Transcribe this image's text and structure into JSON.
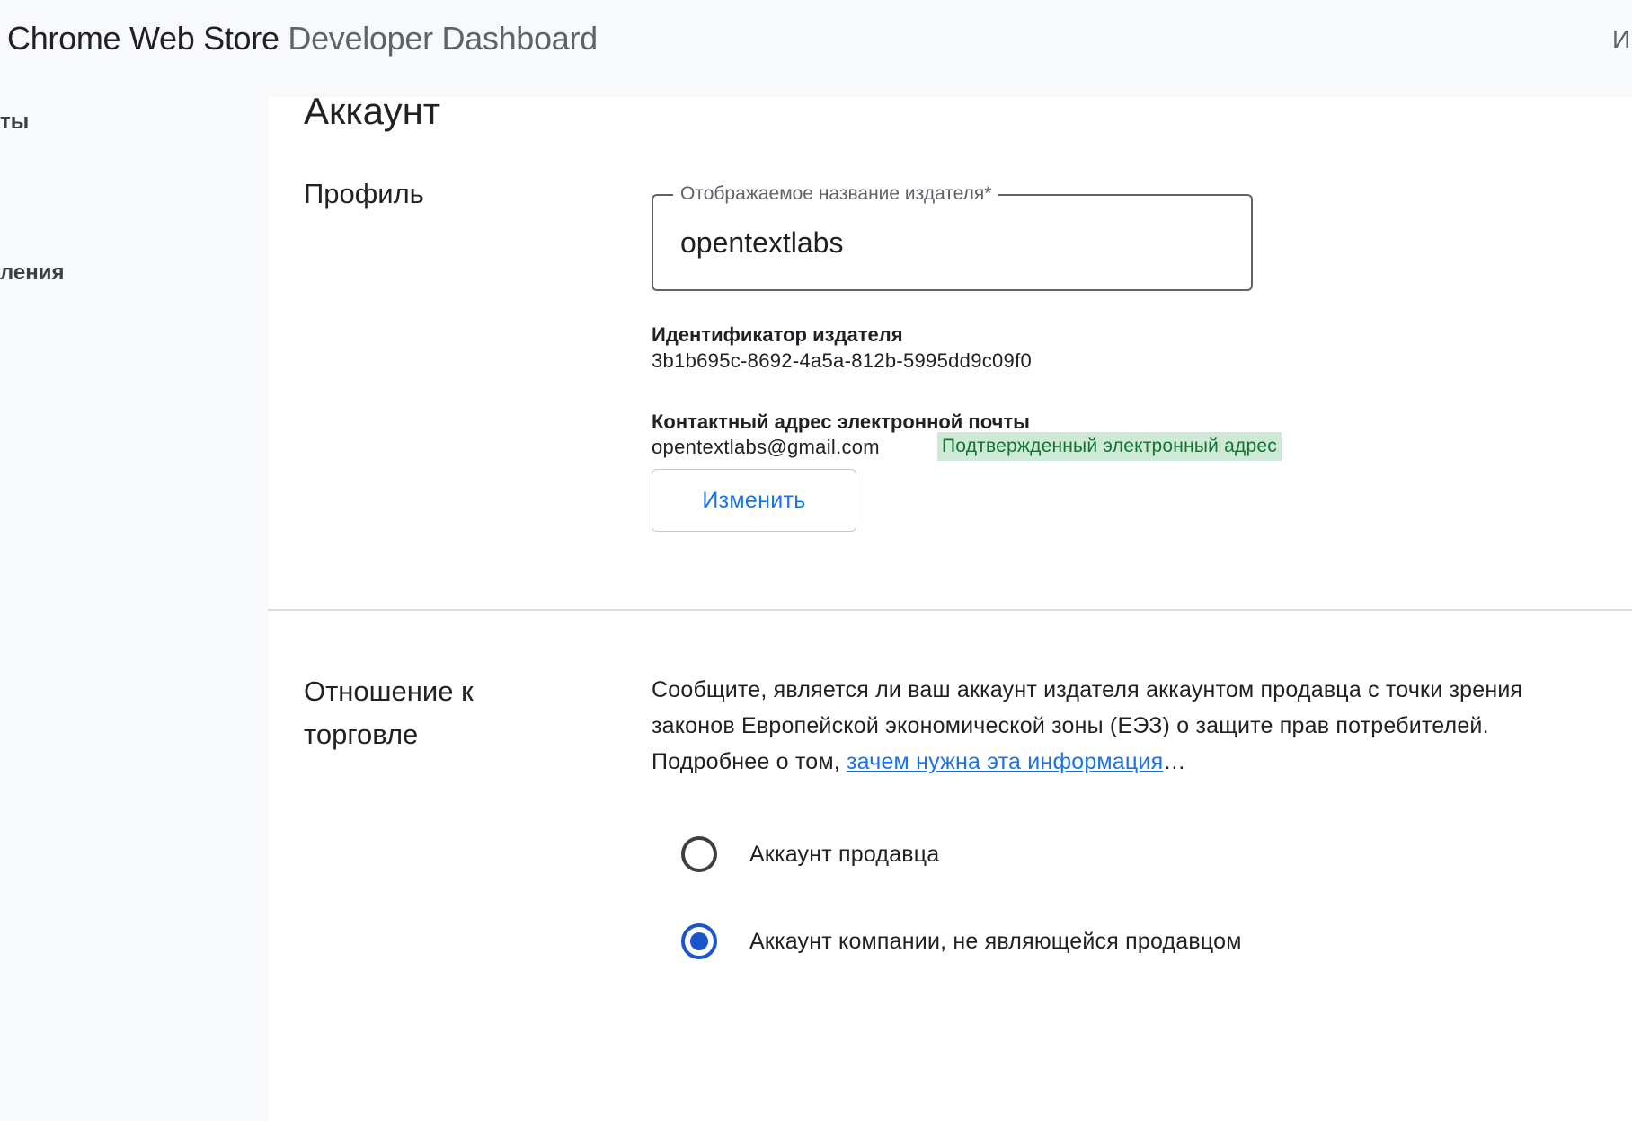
{
  "header": {
    "brand_primary": "Chrome Web Store",
    "brand_secondary": "Developer Dashboard",
    "right_text": "И"
  },
  "sidebar": {
    "items": [
      {
        "label": "ты"
      },
      {
        "label": "ления"
      }
    ]
  },
  "page": {
    "title": "Аккаунт"
  },
  "profile": {
    "section_label": "Профиль",
    "display_name_field": {
      "label": "Отображаемое название издателя*",
      "value": "opentextlabs"
    },
    "publisher_id_label": "Идентификатор издателя",
    "publisher_id_value": "3b1b695c-8692-4a5a-812b-5995dd9c09f0",
    "contact_email_label": "Контактный адрес электронной почты",
    "contact_email_value": "opentextlabs@gmail.com",
    "verified_badge": "Подтвержденный электронный адрес",
    "change_button": "Изменить"
  },
  "trader": {
    "section_label_line1": "Отношение к",
    "section_label_line2": "торговле",
    "description_text": "Сообщите, является ли ваш аккаунт издателя аккаунтом продавца с точки зрения законов Европейской экономической зоны (ЕЭЗ) о защите прав потребителей. Подробнее о том, ",
    "description_link": "зачем нужна эта информация",
    "description_suffix": "…",
    "options": [
      {
        "label": "Аккаунт продавца",
        "selected": false
      },
      {
        "label": "Аккаунт компании, не являющейся продавцом",
        "selected": true
      }
    ]
  },
  "colors": {
    "accent": "#1a73e8",
    "radio_selected": "#1a55c9",
    "badge_bg": "#ceead6",
    "badge_text": "#137333"
  }
}
